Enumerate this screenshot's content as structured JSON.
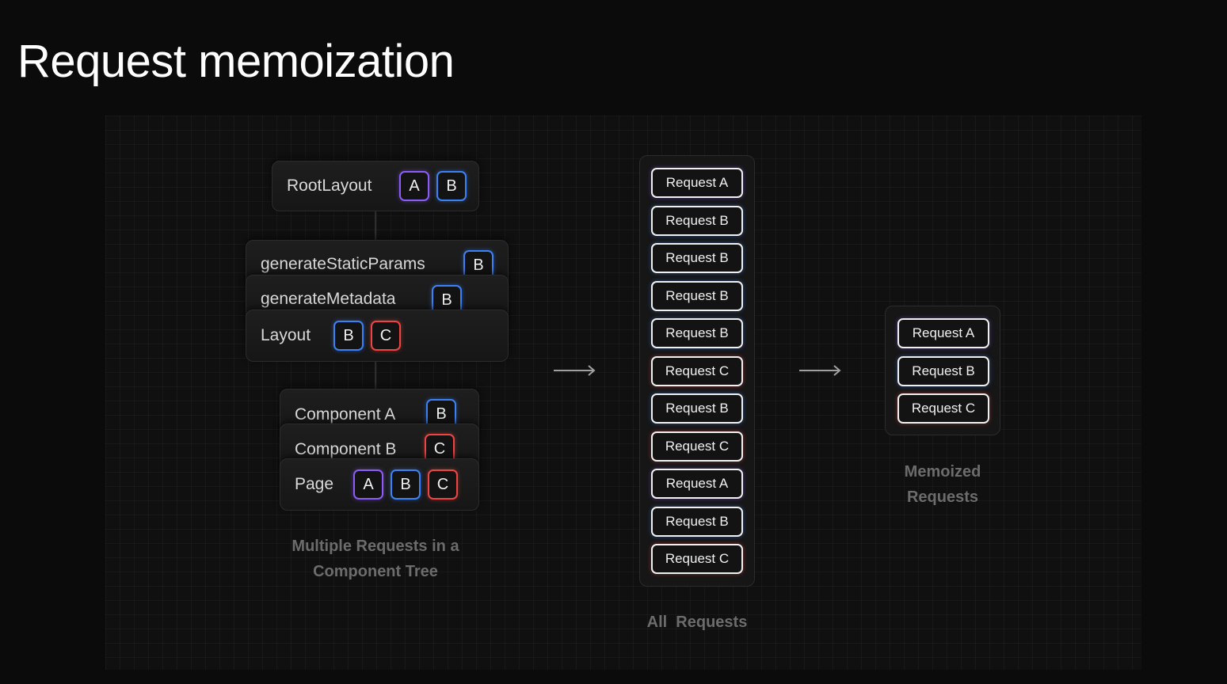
{
  "title": "Request memoization",
  "tree": {
    "caption_line1": "Multiple Requests in a",
    "caption_line2": "Component Tree",
    "root_layout": {
      "label": "RootLayout",
      "badges": [
        "A",
        "B"
      ]
    },
    "generate_static_params": {
      "label": "generateStaticParams",
      "badges": [
        "B"
      ]
    },
    "generate_metadata": {
      "label": "generateMetadata",
      "badges": [
        "B"
      ]
    },
    "layout": {
      "label": "Layout",
      "badges": [
        "B",
        "C"
      ]
    },
    "component_a": {
      "label": "Component A",
      "badges": [
        "B"
      ]
    },
    "component_b": {
      "label": "Component B",
      "badges": [
        "C"
      ]
    },
    "page": {
      "label": "Page",
      "badges": [
        "A",
        "B",
        "C"
      ]
    }
  },
  "all_requests": {
    "caption": "All  Requests",
    "items": [
      "Request A",
      "Request B",
      "Request B",
      "Request B",
      "Request B",
      "Request C",
      "Request B",
      "Request C",
      "Request A",
      "Request B",
      "Request C"
    ]
  },
  "memoized_requests": {
    "caption_line1": "Memoized",
    "caption_line2": "Requests",
    "items": [
      "Request A",
      "Request B",
      "Request C"
    ]
  },
  "colors": {
    "A": "#8b5cf6",
    "B": "#3b82f6",
    "C": "#ef4444"
  },
  "icons": {
    "flow_arrow": "right-arrow-icon"
  }
}
